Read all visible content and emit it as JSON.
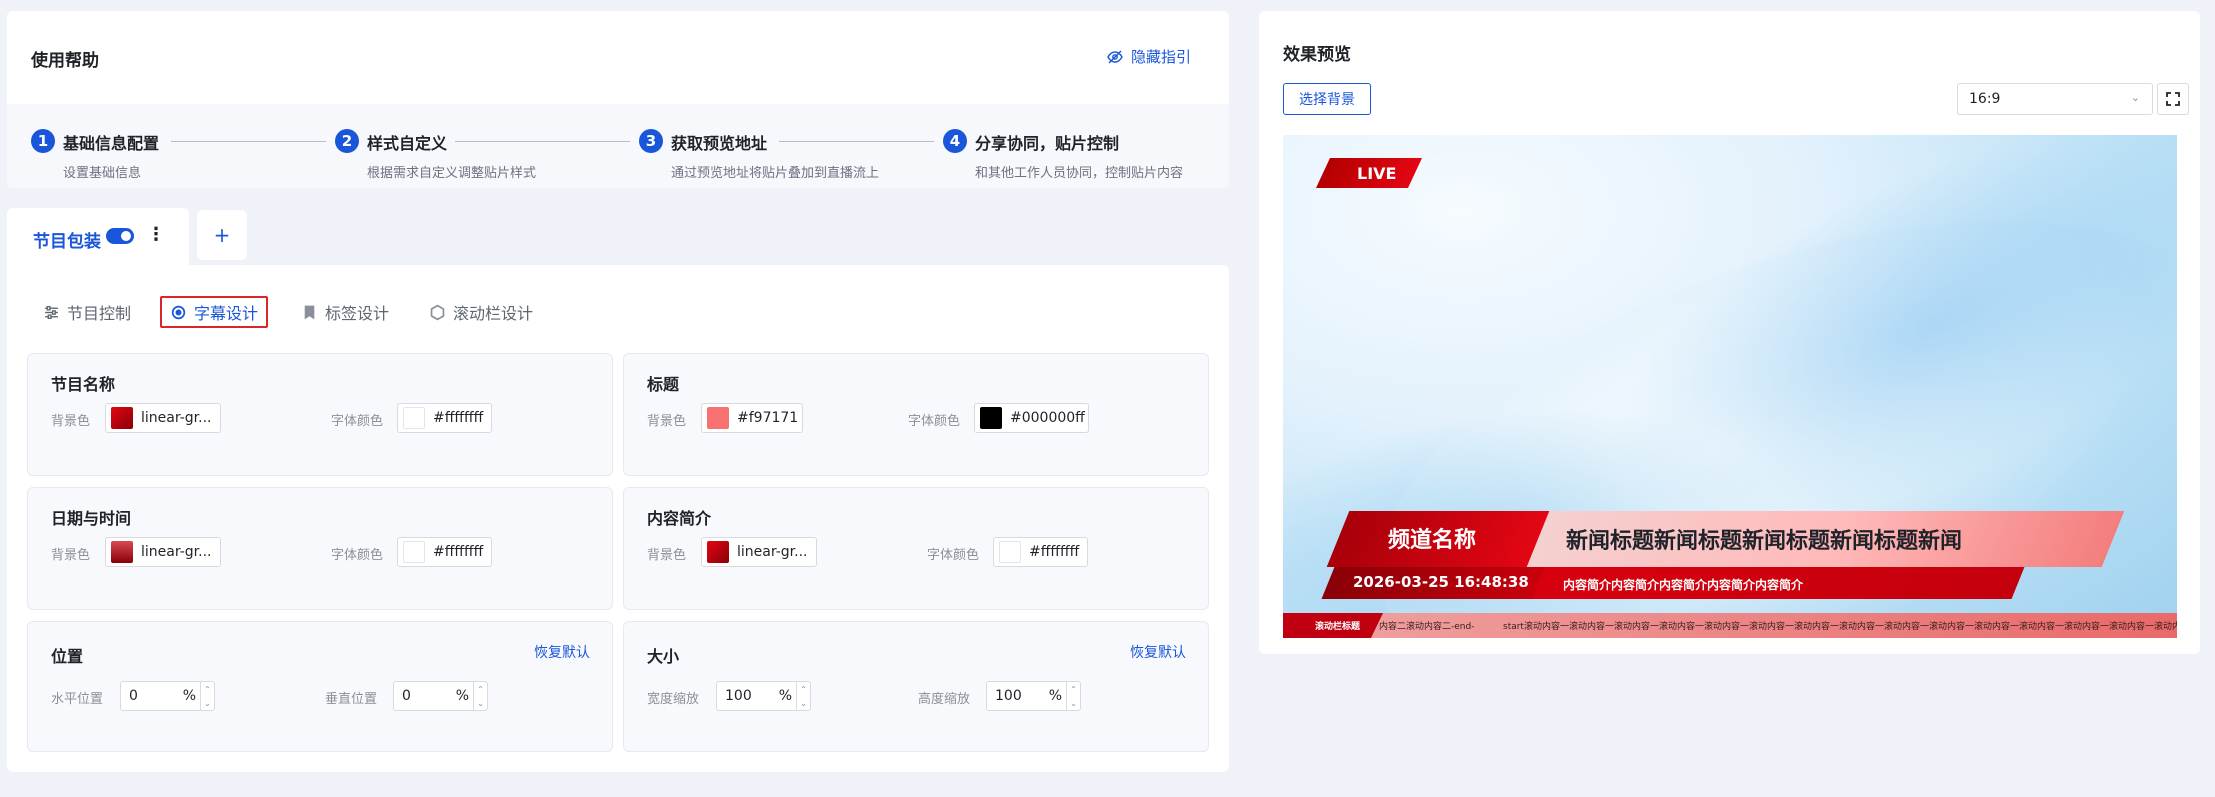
{
  "help": {
    "title": "使用帮助",
    "hide_label": "隐藏指引",
    "steps": [
      {
        "num": "1",
        "title": "基础信息配置",
        "desc": "设置基础信息"
      },
      {
        "num": "2",
        "title": "样式自定义",
        "desc": "根据需求自定义调整贴片样式"
      },
      {
        "num": "3",
        "title": "获取预览地址",
        "desc": "通过预览地址将贴片叠加到直播流上"
      },
      {
        "num": "4",
        "title": "分享协同，贴片控制",
        "desc": "和其他工作人员协同，控制贴片内容"
      }
    ]
  },
  "tabs": {
    "active_label": "节目包装",
    "more": "⋮",
    "add": "+"
  },
  "subtabs": [
    {
      "label": "节目控制",
      "icon": "sliders-icon"
    },
    {
      "label": "字幕设计",
      "icon": "palette-icon"
    },
    {
      "label": "标签设计",
      "icon": "bookmark-icon"
    },
    {
      "label": "滚动栏设计",
      "icon": "scroll-bar-icon"
    }
  ],
  "cards": {
    "program_name": {
      "title": "节目名称",
      "bg_label": "背景色",
      "bg_value": "linear-gr...",
      "bg_color": "#c00010",
      "font_label": "字体颜色",
      "font_value": "#ffffffff",
      "font_color": "#ffffff"
    },
    "heading": {
      "title": "标题",
      "bg_label": "背景色",
      "bg_value": "#f97171",
      "bg_color": "#f97171",
      "font_label": "字体颜色",
      "font_value": "#000000ff",
      "font_color": "#000000"
    },
    "datetime": {
      "title": "日期与时间",
      "bg_label": "背景色",
      "bg_value": "linear-gr...",
      "bg_color": "#b0121e",
      "font_label": "字体颜色",
      "font_value": "#ffffffff",
      "font_color": "#ffffff"
    },
    "intro": {
      "title": "内容简介",
      "bg_label": "背景色",
      "bg_value": "linear-gr...",
      "bg_color": "#c00010",
      "font_label": "字体颜色",
      "font_value": "#ffffffff",
      "font_color": "#ffffff"
    },
    "position": {
      "title": "位置",
      "reset": "恢复默认",
      "h_label": "水平位置",
      "h_value": "0",
      "v_label": "垂直位置",
      "v_value": "0",
      "unit": "%"
    },
    "size": {
      "title": "大小",
      "reset": "恢复默认",
      "w_label": "宽度缩放",
      "w_value": "100",
      "h_label": "高度缩放",
      "h_value": "100",
      "unit": "%"
    }
  },
  "preview": {
    "title": "效果预览",
    "bg_button": "选择背景",
    "ratio": "16:9",
    "live": "LIVE",
    "channel_name": "频道名称",
    "news_title": "新闻标题新闻标题新闻标题新闻标题新闻",
    "datetime": "2026-03-25 16:48:38",
    "intro": "内容简介内容简介内容简介内容简介内容简介",
    "ticker_label": "滚动栏标题",
    "ticker_a": "内容二滚动内容二-end-",
    "ticker_b": "start滚动内容一滚动内容一滚动内容一滚动内容一滚动内容一滚动内容一滚动内容一滚动内容一滚动内容一滚动内容一滚动内容一滚动内容一滚动内容一滚动内容一滚动内容一"
  },
  "colors": {
    "accent": "#1a56d9",
    "live_red": "#e30613"
  }
}
